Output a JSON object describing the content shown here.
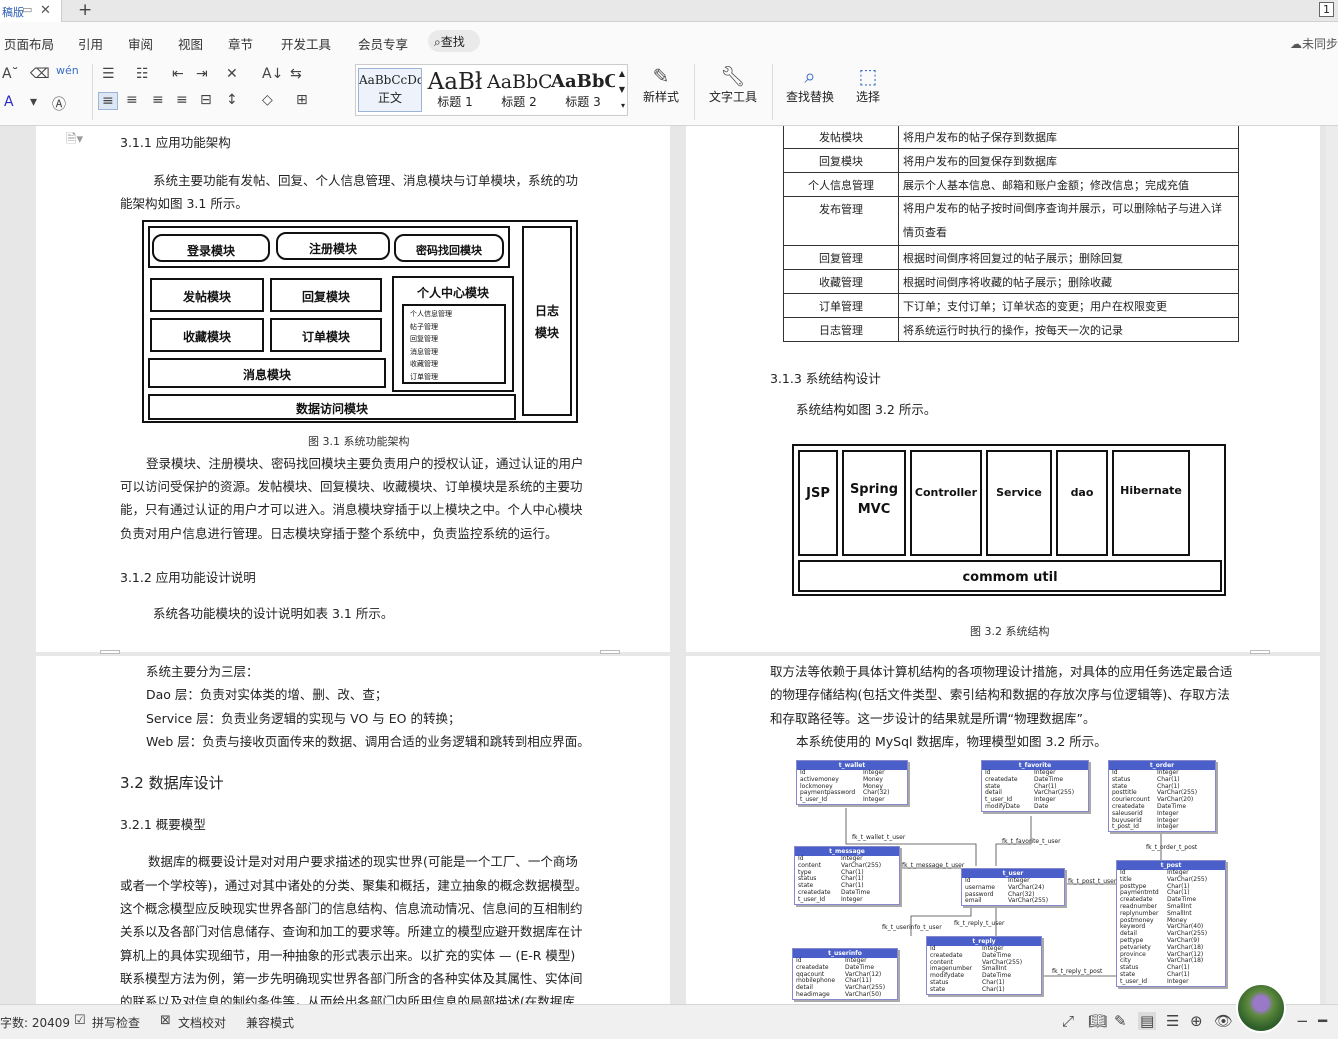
{
  "window": {
    "tab_label": "稿版",
    "page_count": "1"
  },
  "menu": {
    "items": [
      "页面布局",
      "引用",
      "审阅",
      "视图",
      "章节",
      "开发工具",
      "会员专享"
    ],
    "search_label": "查找",
    "cloud_status": "未同步"
  },
  "ribbon": {
    "styles": [
      {
        "sample": "AaBbCcDd",
        "label": "正文"
      },
      {
        "sample": "AaBł",
        "label": "标题 1"
      },
      {
        "sample": "AaBbC",
        "label": "标题 2"
      },
      {
        "sample": "AaBbC",
        "label": "标题 3"
      }
    ],
    "new_style": "新样式",
    "text_tools": "文字工具",
    "find_replace": "查找替换",
    "select": "选择"
  },
  "page1": {
    "h311": "3.1.1 应用功能架构",
    "p1a": "系统主要功能有发帖、回复、个人信息管理、消息模块与订单模块，系统的功",
    "p1b": "能架构如图 3.1 所示。",
    "diagram": {
      "login": "登录模块",
      "register": "注册模块",
      "pwd": "密码找回模块",
      "post": "发帖模块",
      "reply": "回复模块",
      "collect": "收藏模块",
      "order": "订单模块",
      "personal": "个人中心模块",
      "personal_subs": [
        "个人信息管理",
        "帖子管理",
        "回复管理",
        "消息管理",
        "收藏管理",
        "订单管理"
      ],
      "message": "消息模块",
      "data": "数据访问模块",
      "log": "日志模块"
    },
    "fig31": "图 3.1 系统功能架构",
    "p2": [
      "登录模块、注册模块、密码找回模块主要负责用户的授权认证，通过认证的用户",
      "可以访问受保护的资源。发帖模块、回复模块、收藏模块、订单模块是系统的主要功",
      "能，只有通过认证的用户才可以进入。消息模块穿插于以上模块之中。个人中心模块",
      "负责对用户信息进行管理。日志模块穿插于整个系统中，负责监控系统的运行。"
    ],
    "h312": "3.1.2 应用功能设计说明",
    "p3": "系统各功能模块的设计说明如表 3.1 所示。"
  },
  "page2": {
    "table": [
      [
        "发帖模块",
        "将用户发布的帖子保存到数据库"
      ],
      [
        "回复模块",
        "将用户发布的回复保存到数据库"
      ],
      [
        "个人信息管理",
        "展示个人基本信息、邮箱和账户金额；修改信息；完成充值"
      ],
      [
        "发布管理",
        "将用户发布的帖子按时间倒序查询并展示，可以删除帖子与进入详",
        "情页查看"
      ],
      [
        "回复管理",
        "根据时间倒序将回复过的帖子展示；删除回复"
      ],
      [
        "收藏管理",
        "根据时间倒序将收藏的帖子展示；删除收藏"
      ],
      [
        "订单管理",
        "下订单；支付订单；订单状态的变更；用户在权限变更"
      ],
      [
        "日志管理",
        "将系统运行时执行的操作，按每天一次的记录"
      ]
    ],
    "h313": "3.1.3 系统结构设计",
    "p1": "系统结构如图 3.2 所示。",
    "arch": {
      "cols": [
        "JSP",
        "Spring MVC",
        "Controller",
        "Service",
        "dao",
        "Hibernate"
      ],
      "util": "commom util"
    },
    "fig32": "图 3.2 系统结构"
  },
  "page3": {
    "lines": [
      "系统主要分为三层：",
      "Dao 层：负责对实体类的增、删、改、查；",
      "Service 层：负责业务逻辑的实现与 VO 与 EO 的转换；",
      "Web 层：负责与接收页面传来的数据、调用合适的业务逻辑和跳转到相应界面。"
    ],
    "h32": "3.2 数据库设计",
    "h321": "3.2.1 概要模型",
    "p": [
      "数据库的概要设计是对对用户要求描述的现实世界(可能是一个工厂、一个商场",
      "或者一个学校等)，通过对其中诸处的分类、聚集和概括，建立抽象的概念数据模型。",
      "这个概念模型应反映现实世界各部门的信息结构、信息流动情况、信息间的互相制约",
      "关系以及各部门对信息储存、查询和加工的要求等。所建立的模型应避开数据库在计",
      "算机上的具体实现细节，用一种抽象的形式表示出来。以扩充的实体 — (E-R 模型)",
      "联系模型方法为例，第一步先明确现实世界各部门所含的各种实体及其属性、实体间",
      "的联系以及对信息的制约条件等，从而给出各部门内所用信息的局部描述(在数据库"
    ]
  },
  "page4": {
    "p": [
      "取方法等依赖于具体计算机结构的各项物理设计措施，对具体的应用任务选定最合适",
      "的物理存储结构(包括文件类型、索引结构和数据的存放次序与位逻辑等)、存取方法",
      "和存取路径等。这一步设计的结果就是所谓“物理数据库”。"
    ],
    "p2": "本系统使用的 MySql 数据库，物理模型如图 3.2 所示。",
    "er": {
      "t_wallet": {
        "name": "t_wallet",
        "rows": [
          [
            "Id",
            "Integer"
          ],
          [
            "activemoney",
            "Money"
          ],
          [
            "lockmoney",
            "Money"
          ],
          [
            "paymentpassword",
            "Char(32)"
          ],
          [
            "t_user_Id",
            "Integer"
          ]
        ]
      },
      "t_favorite": {
        "name": "t_favorite",
        "rows": [
          [
            "Id",
            "Integer"
          ],
          [
            "createdate",
            "DateTime"
          ],
          [
            "state",
            "Char(1)"
          ],
          [
            "detail",
            "VarChar(255)"
          ],
          [
            "t_user_Id",
            "Integer"
          ],
          [
            "modifyDate",
            "Date"
          ]
        ]
      },
      "t_order": {
        "name": "t_order",
        "rows": [
          [
            "Id",
            "Integer"
          ],
          [
            "status",
            "Char(1)"
          ],
          [
            "state",
            "Char(1)"
          ],
          [
            "posttitle",
            "VarChar(255)"
          ],
          [
            "couriercount",
            "VarChar(20)"
          ],
          [
            "createdate",
            "DateTime"
          ],
          [
            "saleuserid",
            "Integer"
          ],
          [
            "buyuserid",
            "Integer"
          ],
          [
            "t_post_Id",
            "Integer"
          ]
        ]
      },
      "t_message": {
        "name": "t_message",
        "rows": [
          [
            "Id",
            "Integer"
          ],
          [
            "content",
            "VarChar(255)"
          ],
          [
            "type",
            "Char(1)"
          ],
          [
            "status",
            "Char(1)"
          ],
          [
            "state",
            "Char(1)"
          ],
          [
            "createdate",
            "DateTime"
          ],
          [
            "t_user_Id",
            "Integer"
          ]
        ]
      },
      "t_user": {
        "name": "t_user",
        "rows": [
          [
            "Id",
            "Integer"
          ],
          [
            "username",
            "VarChar(24)"
          ],
          [
            "password",
            "Char(32)"
          ],
          [
            "email",
            "VarChar(255)"
          ]
        ]
      },
      "t_post": {
        "name": "t_post",
        "rows": [
          [
            "Id",
            "Integer"
          ],
          [
            "title",
            "VarChar(255)"
          ],
          [
            "posttype",
            "Char(1)"
          ],
          [
            "paymentmtd",
            "Char(1)"
          ],
          [
            "createdate",
            "DateTime"
          ],
          [
            "readnumber",
            "SmallInt"
          ],
          [
            "replynumber",
            "SmallInt"
          ],
          [
            "postmoney",
            "Money"
          ],
          [
            "keyword",
            "VarChar(40)"
          ],
          [
            "detail",
            "VarChar(255)"
          ],
          [
            "pettype",
            "VarChar(9)"
          ],
          [
            "petvariety",
            "VarChar(18)"
          ],
          [
            "province",
            "VarChar(12)"
          ],
          [
            "city",
            "VarChar(18)"
          ],
          [
            "status",
            "Char(1)"
          ],
          [
            "state",
            "Char(1)"
          ],
          [
            "t_user_Id",
            "Integer"
          ]
        ]
      },
      "t_userinfo": {
        "name": "t_userinfo",
        "rows": [
          [
            "Id",
            "Integer"
          ],
          [
            "createdate",
            "DateTime"
          ],
          [
            "qqacount",
            "VarChar(12)"
          ],
          [
            "mobilephone",
            "Char(11)"
          ],
          [
            "detail",
            "VarChar(255)"
          ],
          [
            "headimage",
            "VarChar(50)"
          ]
        ]
      },
      "t_reply": {
        "name": "t_reply",
        "rows": [
          [
            "Id",
            "Integer"
          ],
          [
            "createdate",
            "DateTime"
          ],
          [
            "content",
            "VarChar(255)"
          ],
          [
            "imagenumber",
            "SmallInt"
          ],
          [
            "modifydate",
            "DateTime"
          ],
          [
            "status",
            "Char(1)"
          ],
          [
            "state",
            "Char(1)"
          ]
        ]
      },
      "rels": [
        "fk_t_wallet_t_user",
        "fk_t_favorite_t_user",
        "fk_t_order_t_post",
        "fk_t_message_t_user",
        "fk_t_post_t_user",
        "fk_t_userinfo_t_user",
        "fk_t_reply_t_user",
        "fk_t_reply_t_post"
      ]
    }
  },
  "status": {
    "word_count": "字数: 20409",
    "spell": "拼写检查",
    "proof": "文档校对",
    "compat": "兼容模式"
  }
}
